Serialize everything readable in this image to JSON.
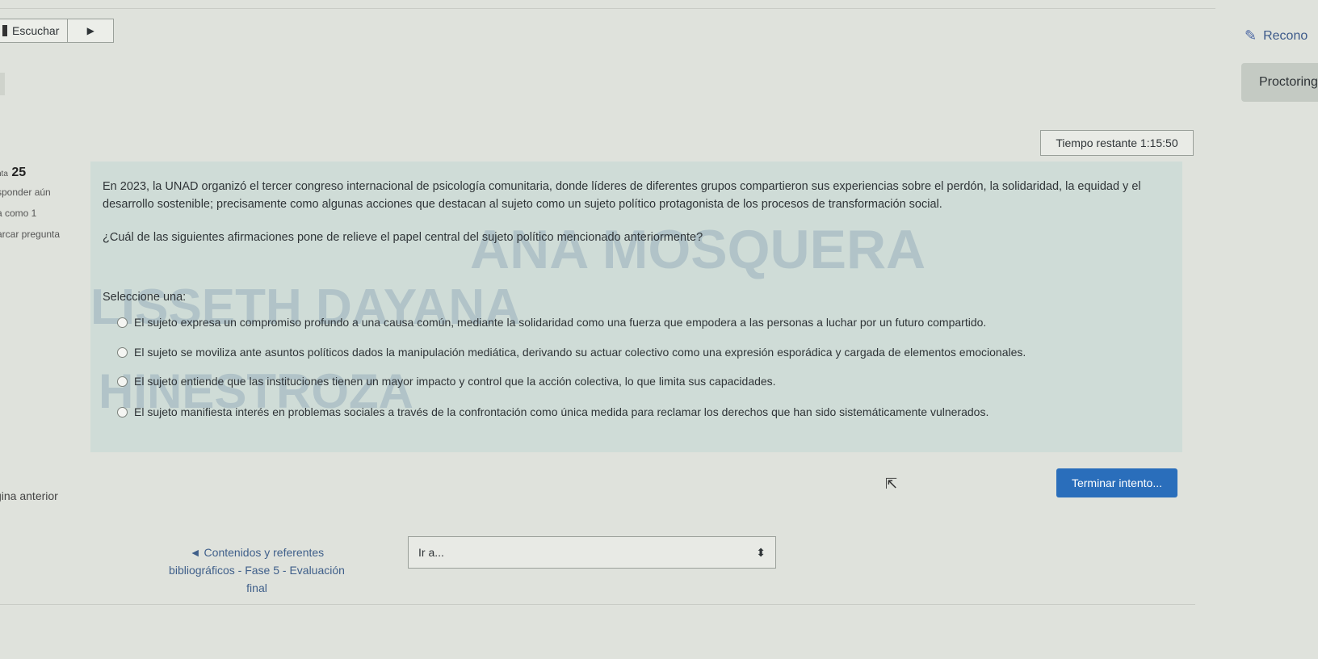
{
  "toolbar": {
    "listen_label": "Escuchar",
    "play_icon": "▶"
  },
  "header": {
    "recognize_label": "Recono",
    "proctoring_label": "Proctoring"
  },
  "timer": {
    "label": "Tiempo restante",
    "value": "1:15:50"
  },
  "question_info": {
    "number_prefix": "nta",
    "number": "25",
    "status": "sponder aún",
    "score": "a como 1",
    "flag_label": "arcar pregunta"
  },
  "question": {
    "text": "En 2023, la UNAD organizó el tercer congreso internacional de psicología comunitaria, donde líderes de diferentes grupos compartieron sus experiencias sobre el perdón, la solidaridad, la equidad y el desarrollo sostenible; precisamente como algunas acciones que destacan al sujeto como un sujeto político protagonista de los procesos de transformación social.",
    "prompt": "¿Cuál de las siguientes afirmaciones pone de relieve el papel central del sujeto político mencionado anteriormente?",
    "select_label": "Seleccione una:",
    "options": [
      "El sujeto expresa un compromiso profundo a una causa común, mediante la solidaridad como una fuerza que empodera a las personas a luchar por un futuro compartido.",
      "El sujeto se moviliza ante asuntos políticos dados la manipulación mediática, derivando su actuar colectivo como una expresión esporádica y cargada de elementos emocionales.",
      "El sujeto entiende que las instituciones tienen un mayor impacto y control que la acción colectiva, lo que limita sus capacidades.",
      "El sujeto manifiesta interés en problemas sociales a través de la confrontación como única medida para reclamar los derechos que han sido sistemáticamente vulnerados."
    ]
  },
  "watermark": {
    "line1": "ANA MOSQUERA",
    "line2": "LISSETH DAYANA",
    "line3": "HINESTROZA"
  },
  "navigation": {
    "prev_label": "gina anterior",
    "finish_label": "Terminar intento...",
    "prev_activity_label": "◄ Contenidos y referentes bibliográficos - Fase 5 - Evaluación final",
    "goto_label": "Ir a..."
  }
}
